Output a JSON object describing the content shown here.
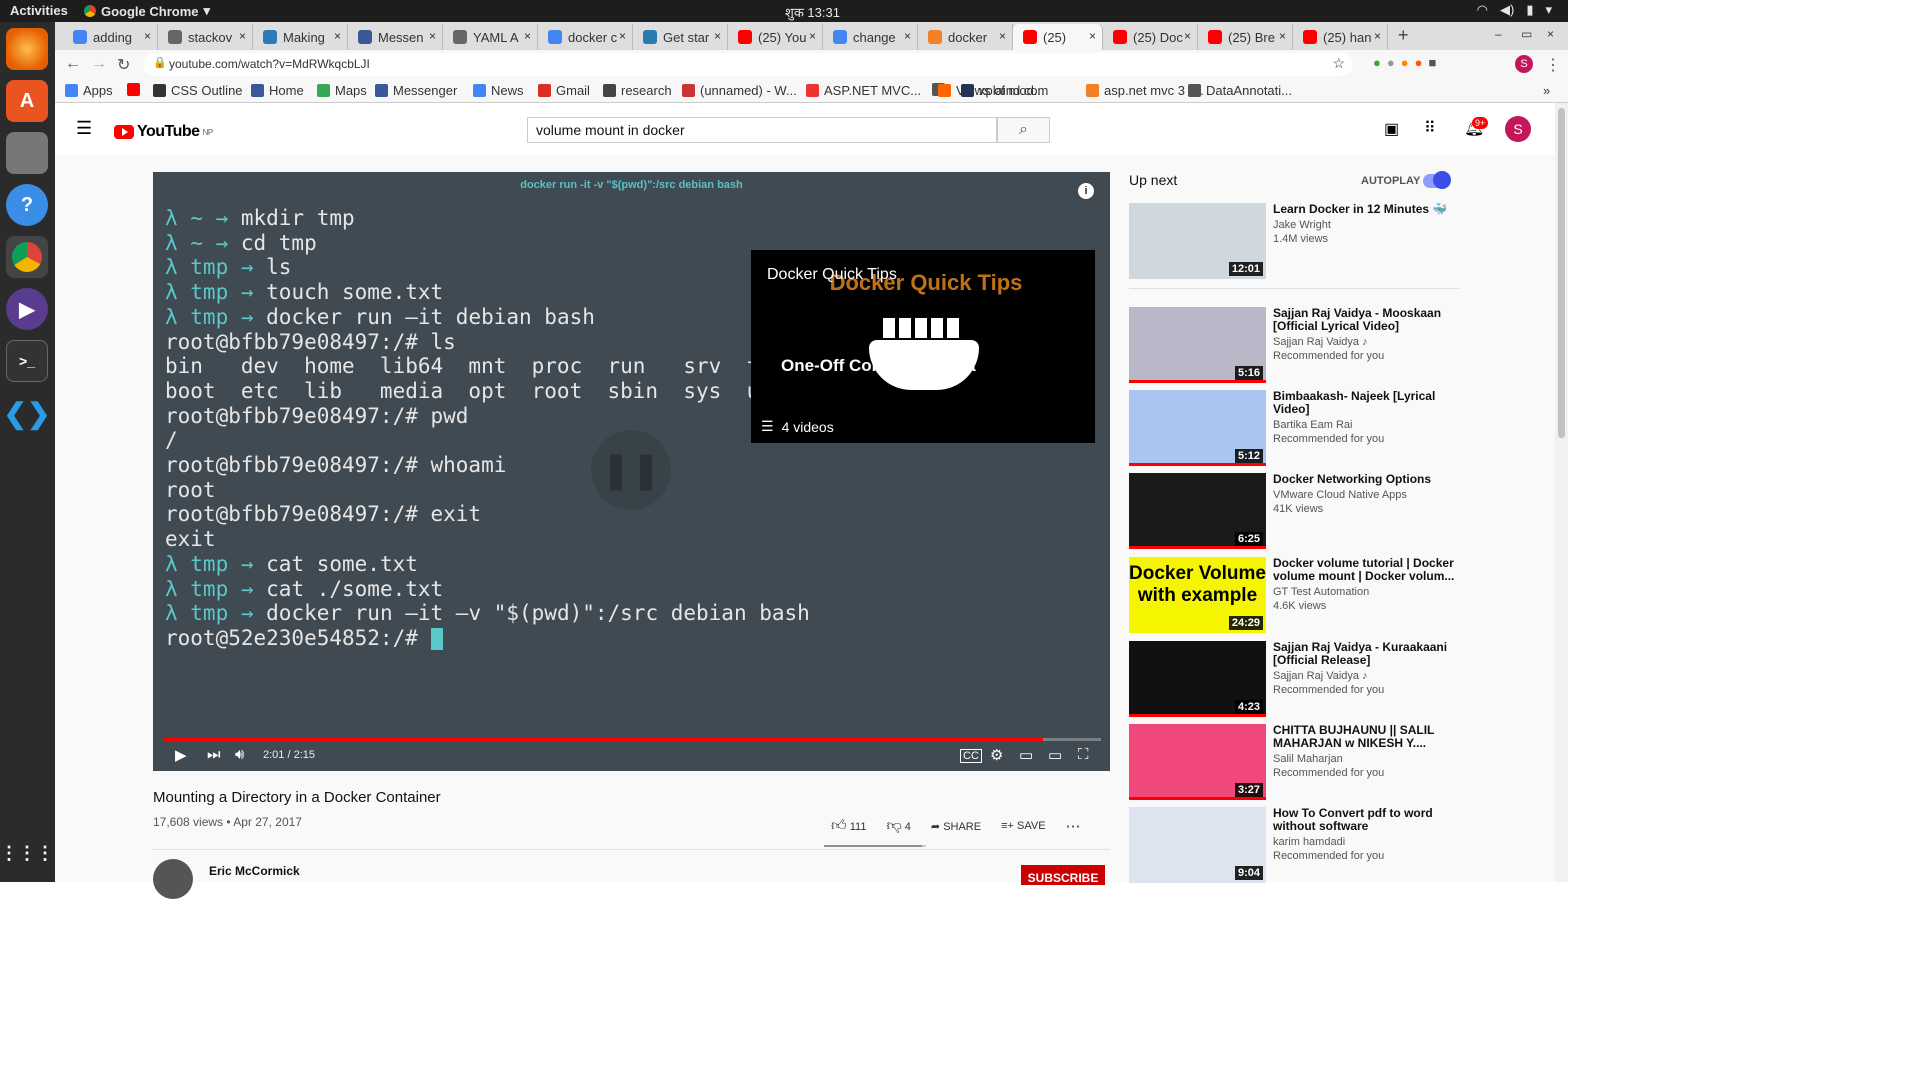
{
  "desktop": {
    "activities": "Activities",
    "app_name": "Google Chrome",
    "clock": "शुक 13:31"
  },
  "tabs": [
    {
      "label": "adding",
      "color": "#4285f4"
    },
    {
      "label": "stackov",
      "color": "#666"
    },
    {
      "label": "Making",
      "color": "#2b7bb9"
    },
    {
      "label": "Messen",
      "color": "#3b5998"
    },
    {
      "label": "YAML A",
      "color": "#666"
    },
    {
      "label": "docker c",
      "color": "#4285f4"
    },
    {
      "label": "Get star",
      "color": "#2a7ab0"
    },
    {
      "label": "(25) You",
      "color": "#f00"
    },
    {
      "label": "change",
      "color": "#4285f4"
    },
    {
      "label": "docker",
      "color": "#f48024"
    },
    {
      "label": "(25)",
      "color": "#f00"
    },
    {
      "label": "(25) Doc",
      "color": "#f00"
    },
    {
      "label": "(25) Bre",
      "color": "#f00"
    },
    {
      "label": "(25) han",
      "color": "#f00"
    }
  ],
  "address": {
    "url": "youtube.com/watch?v=MdRWkqcbLJI"
  },
  "bookmarks": [
    {
      "label": "Apps",
      "color": "#4285f4"
    },
    {
      "label": "",
      "color": "#f00"
    },
    {
      "label": "CSS Outline",
      "color": "#333"
    },
    {
      "label": "Home",
      "color": "#3b5998"
    },
    {
      "label": "Maps",
      "color": "#34a853"
    },
    {
      "label": "Messenger",
      "color": "#3b5998"
    },
    {
      "label": "News",
      "color": "#4285f4"
    },
    {
      "label": "Gmail",
      "color": "#d93025"
    },
    {
      "label": "research",
      "color": "#444"
    },
    {
      "label": "(unnamed) - W...",
      "color": "#c33"
    },
    {
      "label": "ASP.NET MVC...",
      "color": "#e33"
    },
    {
      "label": "",
      "color": "#555"
    },
    {
      "label": "Views of mod...",
      "color": "#f60"
    },
    {
      "label": "xplaind.com",
      "color": "#235"
    },
    {
      "label": "asp.net mvc 3 -...",
      "color": "#f48024"
    },
    {
      "label": "DataAnnotati...",
      "color": "#555"
    }
  ],
  "youtube": {
    "logo_text": "YouTube",
    "logo_region": "NP",
    "search_value": "volume mount in docker",
    "avatar_letter": "S",
    "notif_count": "9+",
    "player": {
      "command_title": "docker run -it -v \"$(pwd)\":/src debian bash",
      "time": "2:01 / 2:15",
      "progress": 0.938,
      "terminal": [
        "λ ~ → mkdir tmp",
        "λ ~ → cd tmp",
        "λ tmp → ls",
        "λ tmp → touch some.txt",
        "λ tmp → docker run –it debian bash",
        "root@bfbb79e08497:/# ls",
        "bin   dev  home  lib64  mnt  proc  run   srv  t",
        "boot  etc  lib   media  opt  root  sbin  sys  u",
        "root@bfbb79e08497:/# pwd",
        "/",
        "root@bfbb79e08497:/# whoami",
        "root",
        "root@bfbb79e08497:/# exit",
        "exit",
        "λ tmp → cat some.txt",
        "λ tmp → cat ./some.txt",
        "λ tmp → docker run –it –v \"$(pwd)\":/src debian bash",
        "root@52e230e54852:/# "
      ],
      "card": {
        "title": "Docker Quick Tips",
        "subtitle": "One-Off Commands in a",
        "playlist": "4 videos"
      }
    },
    "video": {
      "title": "Mounting a Directory in a Docker Container",
      "stats": "17,608 views • Apr 27, 2017",
      "likes": "111",
      "dislikes": "4",
      "share": "SHARE",
      "save": "SAVE",
      "channel": "Eric McCormick",
      "subscribe": "SUBSCRIBE"
    },
    "up_next": {
      "label": "Up next",
      "autoplay": "AUTOPLAY",
      "items": [
        {
          "title": "Learn Docker in 12 Minutes 🐳",
          "channel": "Jake Wright",
          "meta": "1.4M views",
          "duration": "12:01",
          "thumb": "#cfd8dc"
        },
        {
          "title": "Sajjan Raj Vaidya - Mooskaan [Official Lyrical Video]",
          "channel": "Sajjan Raj Vaidya ♪",
          "meta": "Recommended for you",
          "duration": "5:16",
          "thumb": "#b8b8c8"
        },
        {
          "title": "Bimbaakash- Najeek [Lyrical Video]",
          "channel": "Bartika Eam Rai",
          "meta": "Recommended for you",
          "duration": "5:12",
          "thumb": "#a8c6f0"
        },
        {
          "title": "Docker Networking Options",
          "channel": "VMware Cloud Native Apps",
          "meta": "41K views",
          "duration": "6:25",
          "thumb": "#1a1a1a"
        },
        {
          "title": "Docker volume tutorial | Docker volume mount | Docker volum...",
          "channel": "GT Test Automation",
          "meta": "4.6K views",
          "duration": "24:29",
          "thumb": "#f5f500",
          "thumb_text": "Docker Volume with example"
        },
        {
          "title": "Sajjan Raj Vaidya - Kuraakaani [Official Release]",
          "channel": "Sajjan Raj Vaidya ♪",
          "meta": "Recommended for you",
          "duration": "4:23",
          "thumb": "#111"
        },
        {
          "title": "CHITTA BUJHAUNU || SALIL MAHARJAN w NIKESH Y....",
          "channel": "Salil Maharjan",
          "meta": "Recommended for you",
          "duration": "3:27",
          "thumb": "#f0487a"
        },
        {
          "title": "How To Convert pdf to word without software",
          "channel": "karim hamdadi",
          "meta": "Recommended for you",
          "duration": "9:04",
          "thumb": "#dde4f0"
        }
      ]
    }
  }
}
